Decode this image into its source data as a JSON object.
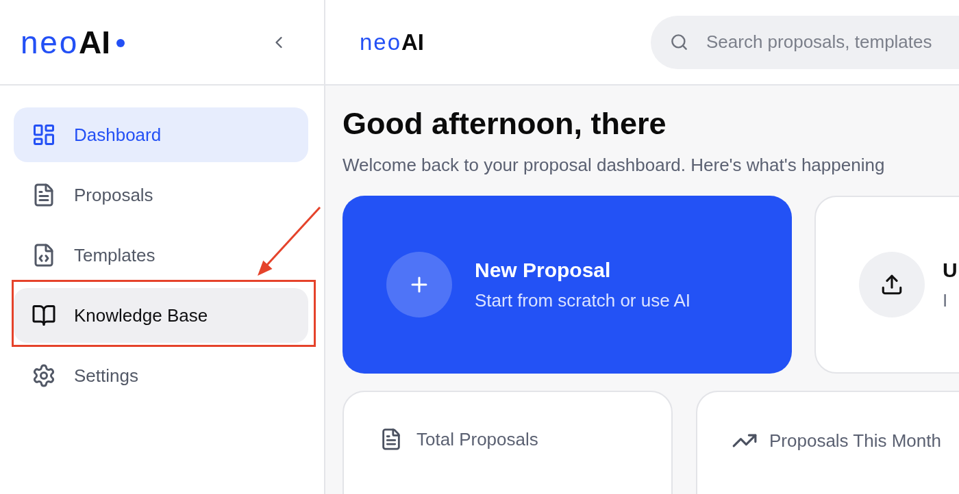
{
  "sidebar": {
    "logo": {
      "light": "neo",
      "bold": "AI"
    },
    "nav_items": [
      {
        "label": "Dashboard",
        "selected": true,
        "hovered": false,
        "highlighted": false
      },
      {
        "label": "Proposals",
        "selected": false,
        "hovered": false,
        "highlighted": false
      },
      {
        "label": "Templates",
        "selected": false,
        "hovered": false,
        "highlighted": false
      },
      {
        "label": "Knowledge Base",
        "selected": false,
        "hovered": true,
        "highlighted": true
      },
      {
        "label": "Settings",
        "selected": false,
        "hovered": false,
        "highlighted": false
      }
    ]
  },
  "header": {
    "logo": {
      "light": "neo",
      "bold": "AI"
    },
    "search": {
      "placeholder": "Search proposals, templates"
    }
  },
  "greeting": {
    "title": "Good afternoon, there",
    "subtitle": "Welcome back to your proposal dashboard. Here's what's happening"
  },
  "action_cards": [
    {
      "kind": "primary",
      "title": "New Proposal",
      "subtitle": "Start from scratch or use AI"
    },
    {
      "kind": "secondary",
      "title": "U",
      "subtitle": "I"
    }
  ],
  "stat_cards": [
    {
      "kind": "total",
      "label": "Total Proposals"
    },
    {
      "kind": "trend",
      "label": "Proposals This Month"
    }
  ]
}
